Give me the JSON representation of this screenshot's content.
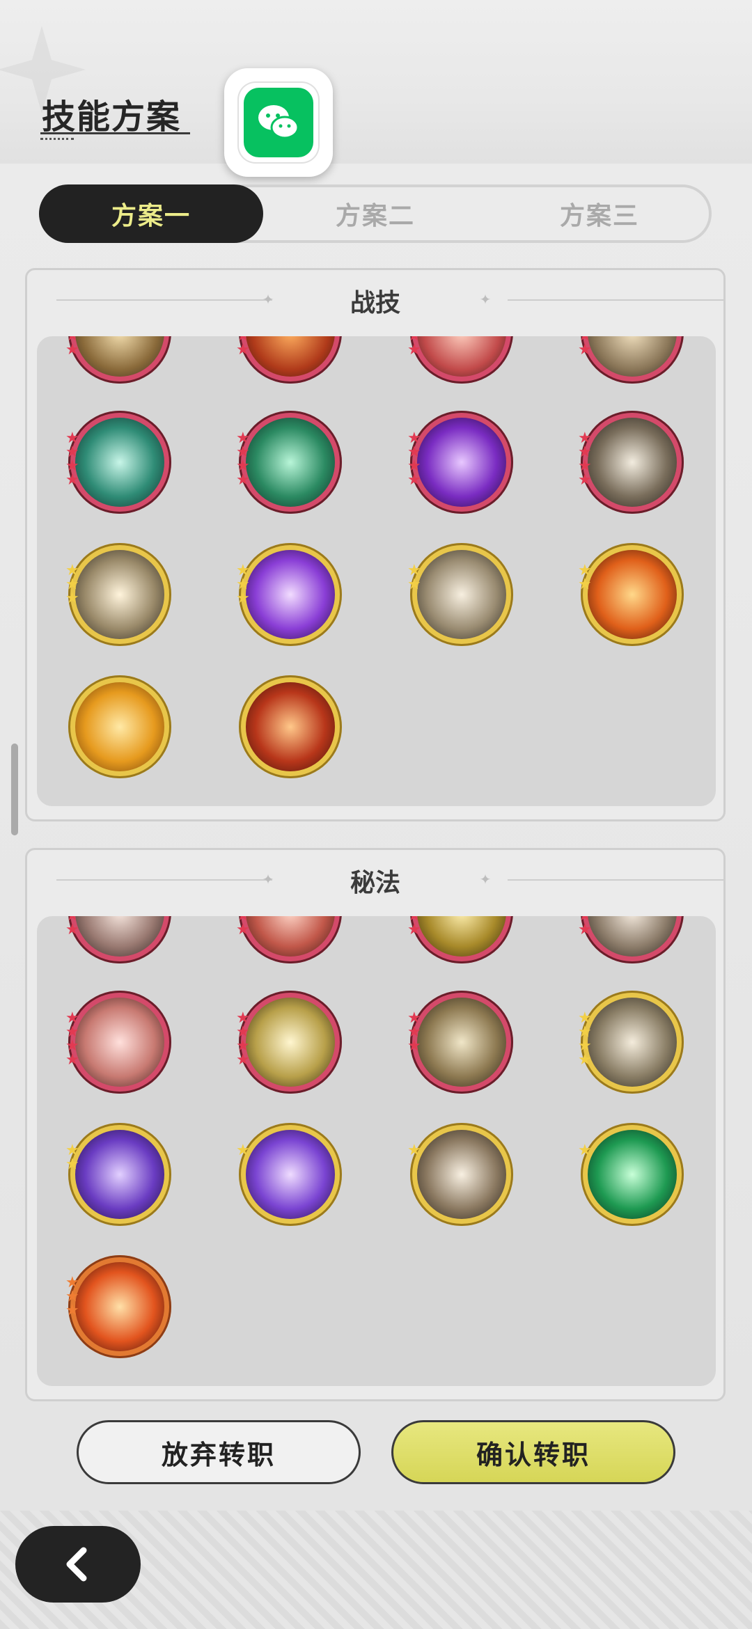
{
  "header": {
    "title": "技能方案"
  },
  "share": {
    "icon": "wechat-icon"
  },
  "tabs": [
    {
      "label": "方案一",
      "active": true
    },
    {
      "label": "方案二",
      "active": false
    },
    {
      "label": "方案三",
      "active": false
    }
  ],
  "panels": {
    "combat": {
      "title": "战技"
    },
    "arcane": {
      "title": "秘法"
    }
  },
  "actions": {
    "cancel_label": "放弃转职",
    "confirm_label": "确认转职"
  },
  "nav": {
    "back_icon": "chevron-left-icon"
  },
  "colors": {
    "tab_active_bg": "#222222",
    "tab_active_text": "#ecec8a",
    "confirm_button": "#dcdc62",
    "rarity_red": "#d44a6a",
    "rarity_gold": "#e8c64a",
    "rarity_orange": "#e27a32"
  }
}
